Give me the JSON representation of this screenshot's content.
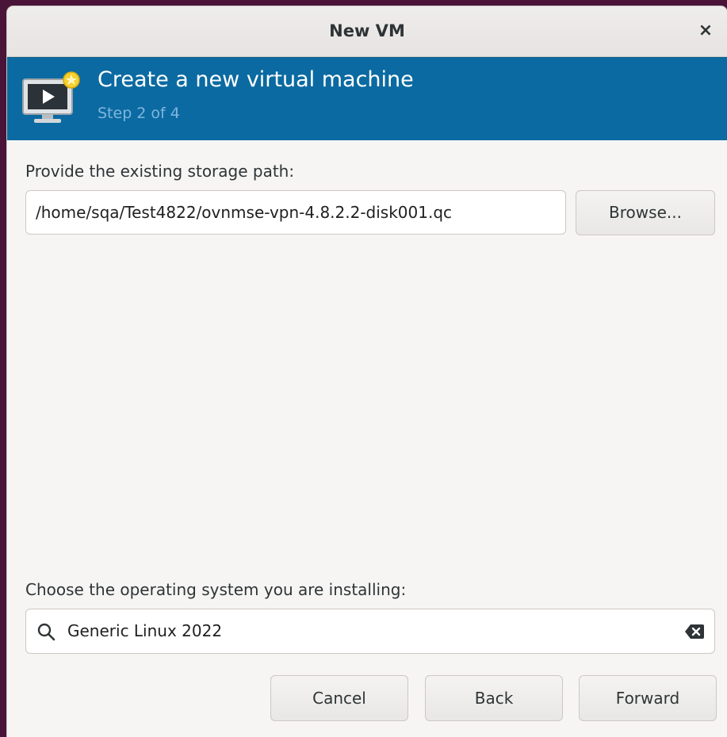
{
  "window": {
    "title": "New VM",
    "close_glyph": "×"
  },
  "banner": {
    "icon": "vm-monitor-icon",
    "title": "Create a new virtual machine",
    "step": "Step 2 of 4"
  },
  "storage": {
    "label": "Provide the existing storage path:",
    "path_value": "/home/sqa/Test4822/ovnmse-vpn-4.8.2.2-disk001.qc",
    "browse_label": "Browse..."
  },
  "os": {
    "label": "Choose the operating system you are installing:",
    "search_value": "Generic Linux 2022",
    "search_icon": "search-icon",
    "clear_icon": "clear-icon"
  },
  "buttons": {
    "cancel": "Cancel",
    "back": "Back",
    "forward": "Forward"
  },
  "colors": {
    "banner_bg": "#0b6aa1",
    "banner_step": "#7fb6dd",
    "window_bg": "#f6f5f4"
  }
}
